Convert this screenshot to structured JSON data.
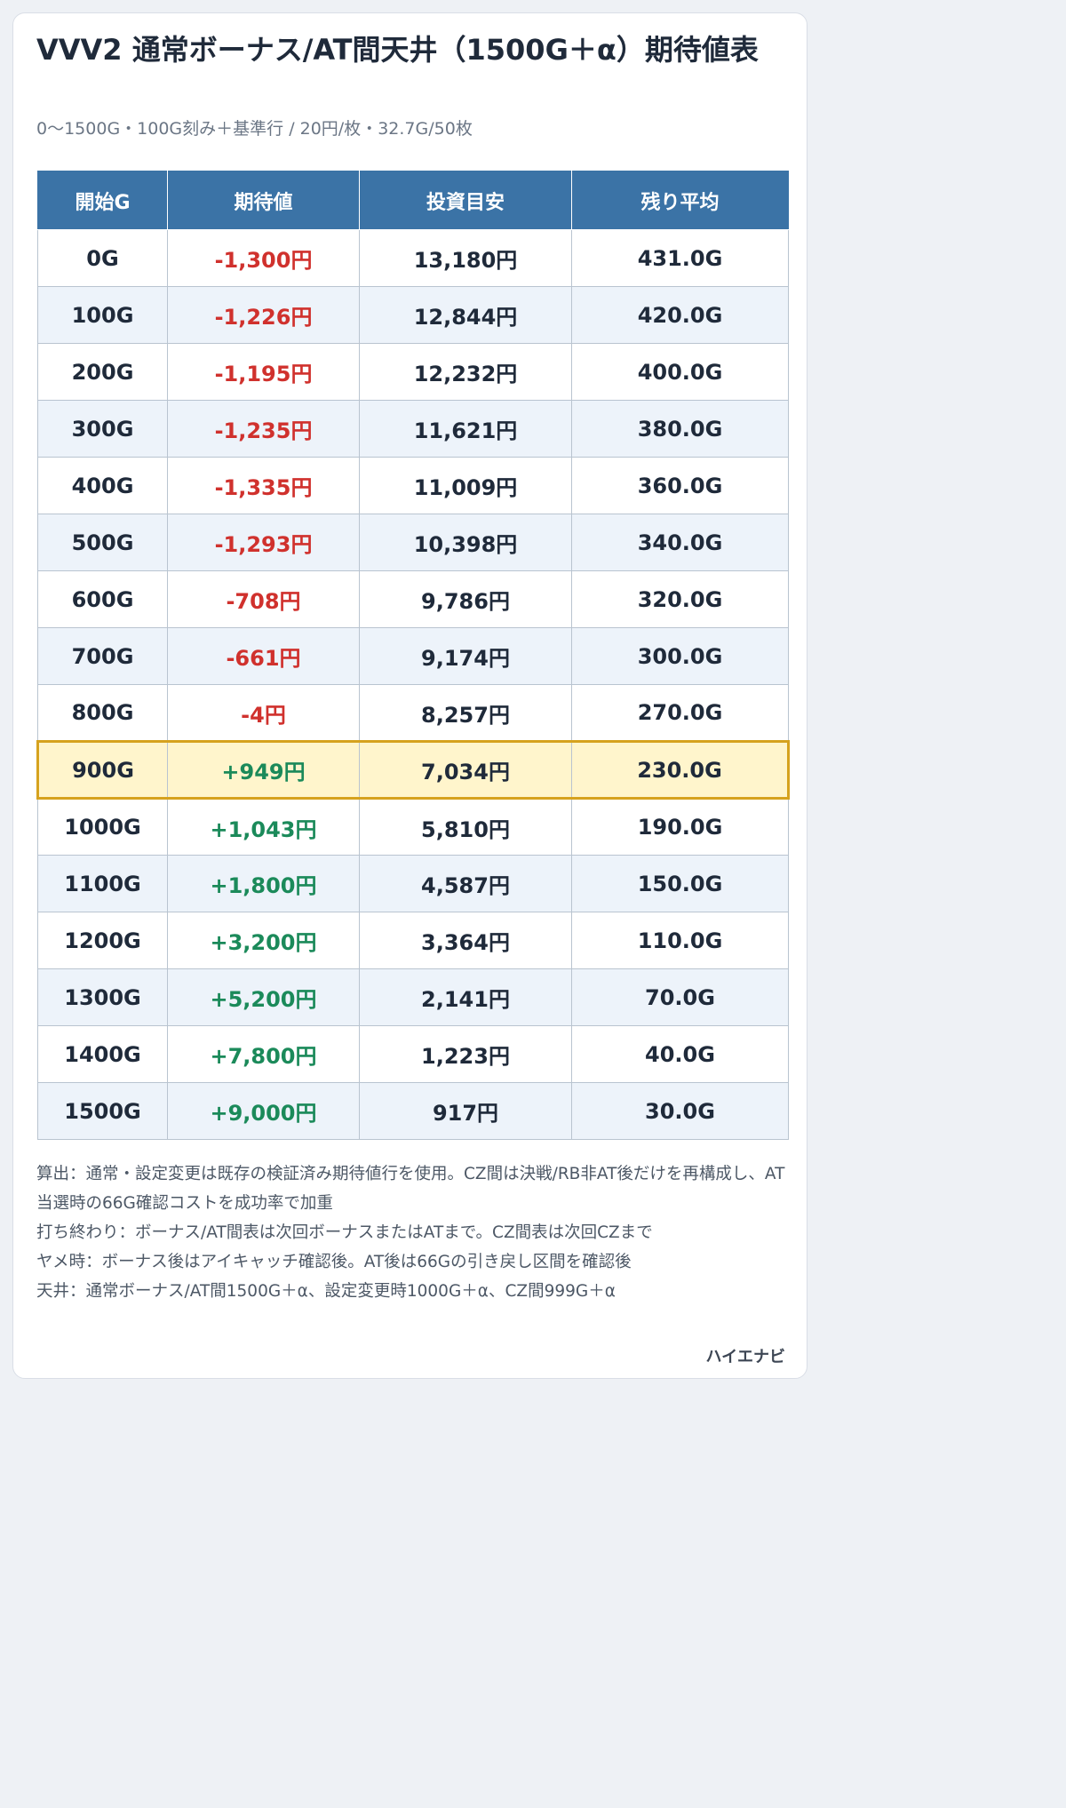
{
  "title": "VVV2 通常ボーナス/AT間天井（1500G＋α）期待値表",
  "subtitle": "0〜1500G・100G刻み＋基準行 / 20円/枚・32.7G/50枚",
  "headers": [
    "開始G",
    "期待値",
    "投資目安",
    "残り平均"
  ],
  "highlight_row": "900G",
  "rows": [
    {
      "start": "0G",
      "ev": "-1,300円",
      "sign": "neg",
      "invest": "13,180円",
      "remain": "431.0G"
    },
    {
      "start": "100G",
      "ev": "-1,226円",
      "sign": "neg",
      "invest": "12,844円",
      "remain": "420.0G"
    },
    {
      "start": "200G",
      "ev": "-1,195円",
      "sign": "neg",
      "invest": "12,232円",
      "remain": "400.0G"
    },
    {
      "start": "300G",
      "ev": "-1,235円",
      "sign": "neg",
      "invest": "11,621円",
      "remain": "380.0G"
    },
    {
      "start": "400G",
      "ev": "-1,335円",
      "sign": "neg",
      "invest": "11,009円",
      "remain": "360.0G"
    },
    {
      "start": "500G",
      "ev": "-1,293円",
      "sign": "neg",
      "invest": "10,398円",
      "remain": "340.0G"
    },
    {
      "start": "600G",
      "ev": "-708円",
      "sign": "neg",
      "invest": "9,786円",
      "remain": "320.0G"
    },
    {
      "start": "700G",
      "ev": "-661円",
      "sign": "neg",
      "invest": "9,174円",
      "remain": "300.0G"
    },
    {
      "start": "800G",
      "ev": "-4円",
      "sign": "neg",
      "invest": "8,257円",
      "remain": "270.0G"
    },
    {
      "start": "900G",
      "ev": "+949円",
      "sign": "pos",
      "invest": "7,034円",
      "remain": "230.0G"
    },
    {
      "start": "1000G",
      "ev": "+1,043円",
      "sign": "pos",
      "invest": "5,810円",
      "remain": "190.0G"
    },
    {
      "start": "1100G",
      "ev": "+1,800円",
      "sign": "pos",
      "invest": "4,587円",
      "remain": "150.0G"
    },
    {
      "start": "1200G",
      "ev": "+3,200円",
      "sign": "pos",
      "invest": "3,364円",
      "remain": "110.0G"
    },
    {
      "start": "1300G",
      "ev": "+5,200円",
      "sign": "pos",
      "invest": "2,141円",
      "remain": "70.0G"
    },
    {
      "start": "1400G",
      "ev": "+7,800円",
      "sign": "pos",
      "invest": "1,223円",
      "remain": "40.0G"
    },
    {
      "start": "1500G",
      "ev": "+9,000円",
      "sign": "pos",
      "invest": "917円",
      "remain": "30.0G"
    }
  ],
  "notes": [
    "算出：通常・設定変更は既存の検証済み期待値行を使用。CZ間は決戦/RB非AT後だけを再構成し、AT当選時の66G確認コストを成功率で加重",
    "打ち終わり：ボーナス/AT間表は次回ボーナスまたはATまで。CZ間表は次回CZまで",
    "ヤメ時：ボーナス後はアイキャッチ確認後。AT後は66Gの引き戻し区間を確認後",
    "天井：通常ボーナス/AT間1500G＋α、設定変更時1000G＋α、CZ間999G＋α"
  ],
  "brand": "ハイエナビ",
  "colors": {
    "header_bg": "#3b73a6",
    "negative": "#d0312d",
    "positive": "#1b8a5a",
    "highlight_bg": "#fff5cc",
    "highlight_border": "#d6a21e",
    "alt_row_bg": "#edf3fa"
  }
}
